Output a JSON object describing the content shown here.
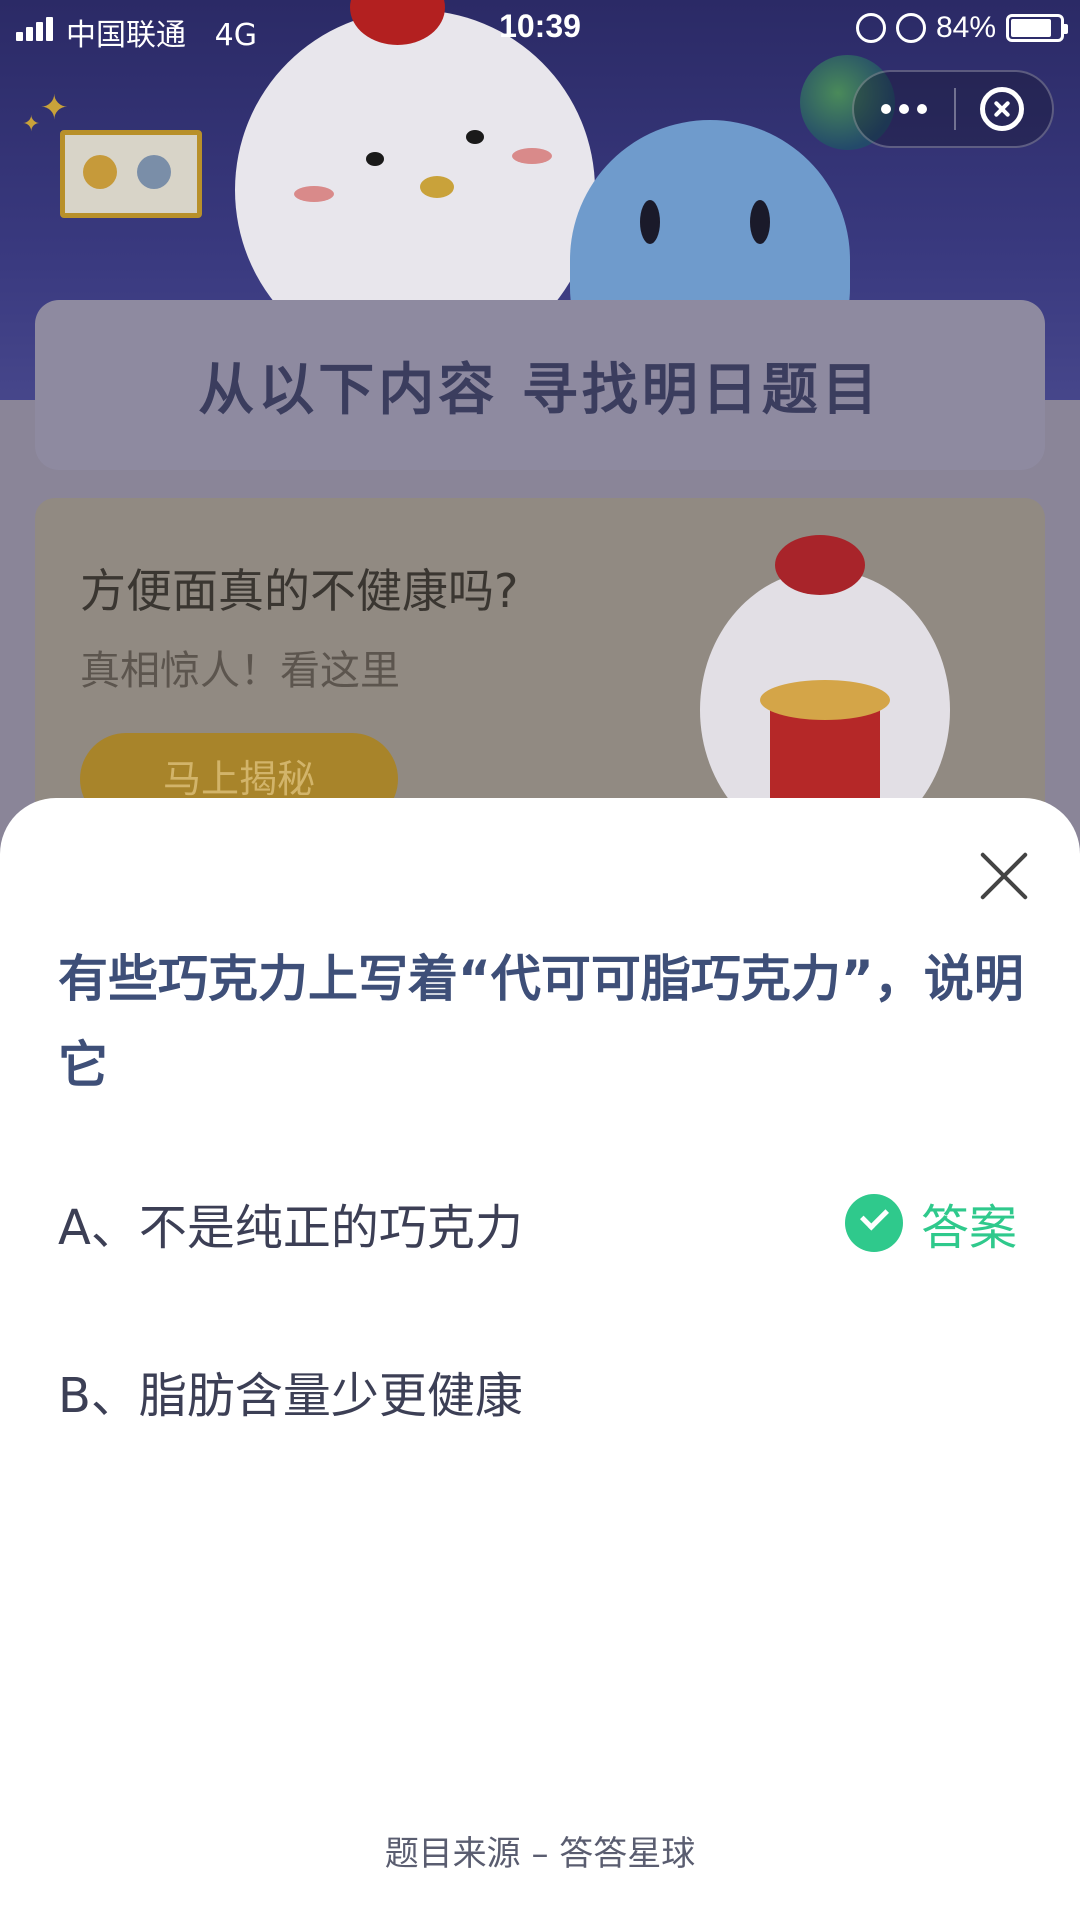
{
  "status_bar": {
    "carrier": "中国联通",
    "network": "4G",
    "time": "10:39",
    "battery_percent": "84%"
  },
  "capsule": {
    "more_icon": "more-dots-icon",
    "close_icon": "close-circle-icon"
  },
  "background": {
    "find_title": "从以下内容 寻找明日题目",
    "article_title": "方便面真的不健康吗?",
    "article_subtitle": "真相惊人！看这里",
    "reveal_button": "马上揭秘"
  },
  "sheet": {
    "question": "有些巧克力上写着“代可可脂巧克力”，说明它",
    "options": [
      {
        "label": "A、不是纯正的巧克力",
        "is_answer": true
      },
      {
        "label": "B、脂肪含量少更健康",
        "is_answer": false
      }
    ],
    "answer_label": "答案",
    "source": "题目来源 – 答答星球"
  },
  "colors": {
    "question": "#3e4f78",
    "answer_green": "#2fc98c"
  }
}
